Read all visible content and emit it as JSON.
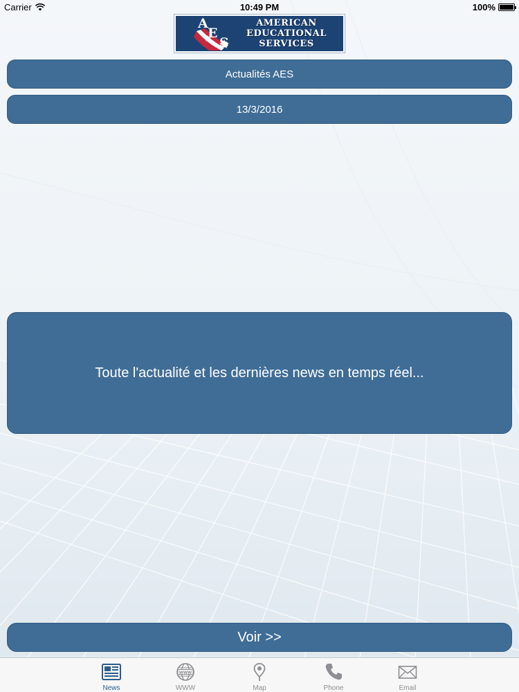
{
  "status_bar": {
    "carrier": "Carrier",
    "time": "10:49 PM",
    "battery": "100%",
    "battery_level": 1.0
  },
  "logo": {
    "monogram": [
      "A",
      "E",
      "S"
    ],
    "lines": [
      "AMERICAN",
      "EDUCATIONAL",
      "SERVICES"
    ]
  },
  "news": {
    "title": "Actualités AES",
    "date": "13/3/2016",
    "description": "Toute l'actualité et les dernières news en temps réel...",
    "view_button": "Voir >>"
  },
  "tabs": [
    {
      "label": "News",
      "icon": "newspaper-icon",
      "active": true
    },
    {
      "label": "WWW",
      "icon": "globe-icon",
      "active": false
    },
    {
      "label": "Map",
      "icon": "map-pin-icon",
      "active": false
    },
    {
      "label": "Phone",
      "icon": "phone-icon",
      "active": false
    },
    {
      "label": "Email",
      "icon": "envelope-icon",
      "active": false
    }
  ],
  "colors": {
    "accent": "#3f6d96",
    "logo_bg": "#1c4374",
    "tab_active": "#2c5c88",
    "tab_inactive": "#8e8e93"
  }
}
